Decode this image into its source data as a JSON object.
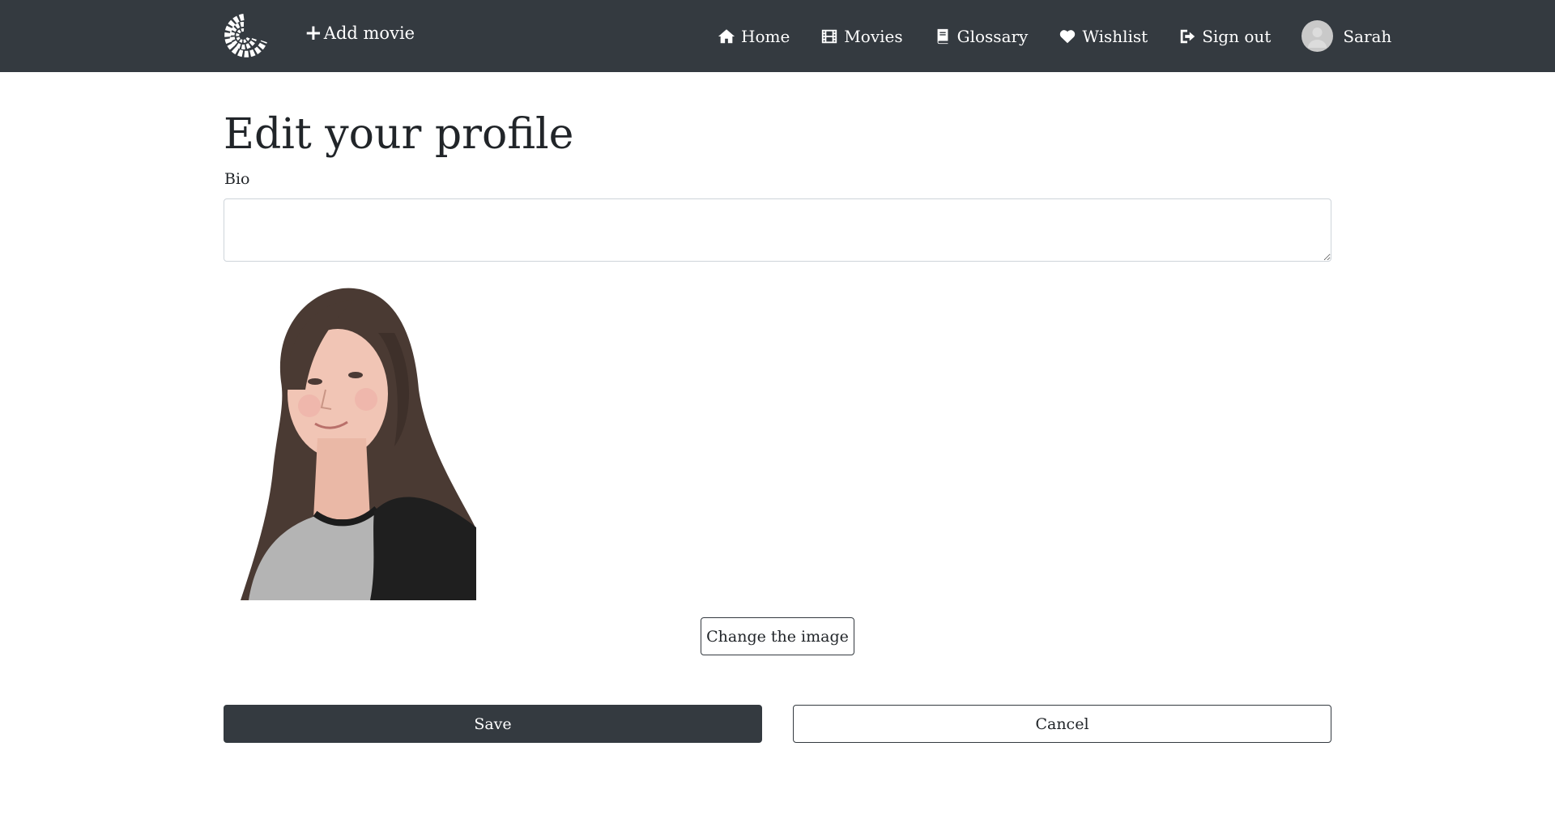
{
  "navbar": {
    "logo_icon": "spiral-film-logo",
    "add_movie_label": "Add movie",
    "links": [
      {
        "label": "Home",
        "icon": "home-icon"
      },
      {
        "label": "Movies",
        "icon": "film-icon"
      },
      {
        "label": "Glossary",
        "icon": "book-icon"
      },
      {
        "label": "Wishlist",
        "icon": "heart-icon"
      },
      {
        "label": "Sign out",
        "icon": "sign-out-icon"
      }
    ],
    "user_name": "Sarah",
    "background_color": "#343a40"
  },
  "main": {
    "title": "Edit your profile",
    "bio_label": "Bio",
    "bio_value": "",
    "change_image_label": "Change the image",
    "save_label": "Save",
    "cancel_label": "Cancel"
  }
}
